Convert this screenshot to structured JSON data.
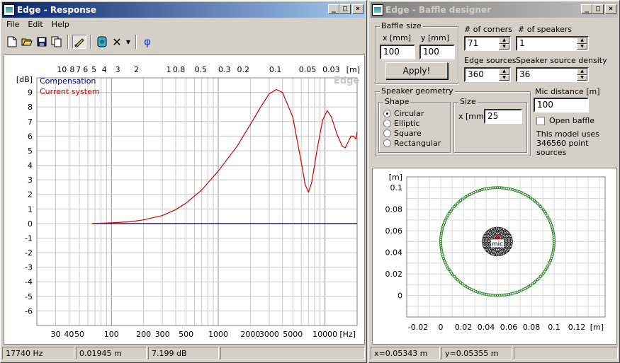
{
  "response_window": {
    "title": "Edge - Response",
    "menu": [
      "File",
      "Edit",
      "Help"
    ],
    "toolbar_icons": [
      "new-icon",
      "open-icon",
      "save-icon",
      "copy-icon",
      "pen-icon",
      "speaker-icon",
      "delete-icon",
      "dropdown-icon",
      "phase-icon"
    ],
    "phase_symbol": "φ",
    "status": {
      "frequency": "17740 Hz",
      "distance": "0.01945 m",
      "level": "7.199 dB",
      "extra": ""
    }
  },
  "designer_window": {
    "title": "Edge - Baffle designer",
    "baffle_size": {
      "title": "Baffle size",
      "x_label": "x [mm]",
      "y_label": "y [mm]",
      "x_value": "100",
      "y_value": "100",
      "apply_label": "Apply!"
    },
    "corners": {
      "label": "# of corners",
      "value": "71"
    },
    "speakers": {
      "label": "# of speakers",
      "value": "1"
    },
    "edge_sources": {
      "label": "Edge sources",
      "value": "360"
    },
    "speaker_density": {
      "label": "Speaker source density",
      "value": "36"
    },
    "speaker_geometry": {
      "title": "Speaker geometry",
      "shape_title": "Shape",
      "shapes": [
        "Circular",
        "Elliptic",
        "Square",
        "Rectangular"
      ],
      "selected": "Circular",
      "size_title": "Size",
      "size_label": "x [mm]",
      "size_value": "25"
    },
    "mic_distance": {
      "label": "Mic distance [m]",
      "value": "100"
    },
    "open_baffle_label": "Open baffle",
    "model_info": "This model uses 346560 point sources",
    "status": {
      "x": "x=0.05343 m",
      "y": "y=0.05355 m",
      "extra": ""
    }
  },
  "chart_data": [
    {
      "type": "line",
      "title": "",
      "xscale": "log",
      "xlabel": "[Hz]",
      "ylabel": "[dB]",
      "xlim": [
        20,
        20000
      ],
      "ylim": [
        -7,
        10
      ],
      "top_axis_label": "[m]",
      "watermark": "Edge",
      "x_ticks": [
        "30",
        "40",
        "50",
        "100",
        "200",
        "300",
        "500",
        "1000",
        "2000",
        "3000",
        "5000",
        "10000",
        "[Hz]"
      ],
      "top_ticks": [
        "10",
        "8",
        "7",
        "6",
        "5",
        "4",
        "3",
        "2",
        "1",
        "0.8",
        "0.5",
        "0.3",
        "0.2",
        "0.1",
        "0.05",
        "0.03",
        "[m]"
      ],
      "y_ticks": [
        "9",
        "8",
        "7",
        "6",
        "5",
        "4",
        "3",
        "2",
        "1",
        "0",
        "-1",
        "-2",
        "-3",
        "-4",
        "-5",
        "-6"
      ],
      "series": [
        {
          "name": "Compensation",
          "color": "#000080",
          "points": [
            [
              66,
              0
            ],
            [
              20000,
              0
            ]
          ]
        },
        {
          "name": "Current system",
          "color": "#cc0000",
          "points": [
            [
              66,
              0
            ],
            [
              100,
              0.05
            ],
            [
              150,
              0.12
            ],
            [
              200,
              0.25
            ],
            [
              300,
              0.55
            ],
            [
              400,
              0.95
            ],
            [
              500,
              1.4
            ],
            [
              700,
              2.3
            ],
            [
              1000,
              3.6
            ],
            [
              1500,
              5.3
            ],
            [
              2000,
              6.8
            ],
            [
              2500,
              8.0
            ],
            [
              3000,
              8.9
            ],
            [
              3500,
              9.2
            ],
            [
              4000,
              9.0
            ],
            [
              5000,
              7.3
            ],
            [
              6000,
              4.2
            ],
            [
              6500,
              2.7
            ],
            [
              7000,
              2.15
            ],
            [
              7500,
              2.8
            ],
            [
              8500,
              5.2
            ],
            [
              9500,
              7.1
            ],
            [
              10500,
              7.75
            ],
            [
              11500,
              7.3
            ],
            [
              13000,
              6.1
            ],
            [
              14500,
              5.3
            ],
            [
              15500,
              5.2
            ],
            [
              16500,
              5.6
            ],
            [
              17500,
              6.0
            ],
            [
              18500,
              6.0
            ],
            [
              19500,
              5.8
            ],
            [
              20000,
              6.3
            ]
          ]
        }
      ]
    },
    {
      "type": "scatter",
      "title": "",
      "xlabel": "[m]",
      "ylabel": "[m]",
      "xlim": [
        -0.03,
        0.145
      ],
      "ylim": [
        -0.02,
        0.11
      ],
      "x_ticks": [
        "-0.02",
        "0",
        "0.02",
        "0.04",
        "0.06",
        "0.08",
        "0.1",
        "0.12",
        "[m]"
      ],
      "y_ticks": [
        "0.1",
        "0.08",
        "0.06",
        "0.04",
        "0.02",
        "0"
      ],
      "baffle": {
        "center": [
          0.05,
          0.05
        ],
        "radius": 0.05,
        "color": "#1f7a1f"
      },
      "speaker": {
        "center": [
          0.05,
          0.05
        ],
        "radius": 0.0125,
        "color": "#000000"
      },
      "mic_label": "mic"
    }
  ]
}
